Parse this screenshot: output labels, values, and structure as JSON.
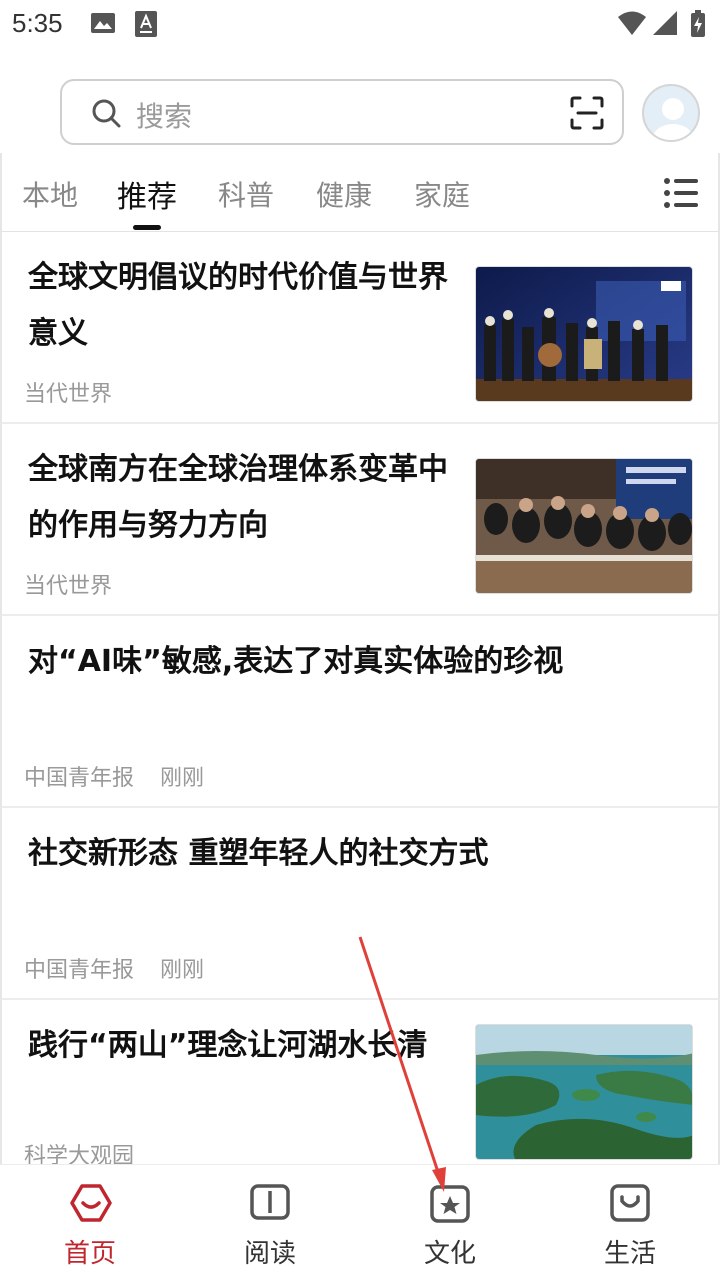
{
  "status_bar": {
    "time": "5:35"
  },
  "search": {
    "placeholder": "搜索"
  },
  "tabs": [
    {
      "label": "本地"
    },
    {
      "label": "推荐"
    },
    {
      "label": "科普"
    },
    {
      "label": "健康"
    },
    {
      "label": "家庭"
    }
  ],
  "news": [
    {
      "title": "全球文明倡议的时代价值与世界意义",
      "source": "当代世界",
      "time": ""
    },
    {
      "title": "全球南方在全球治理体系变革中的作用与努力方向",
      "source": "当代世界",
      "time": ""
    },
    {
      "title": "对“AI味”敏感,表达了对真实体验的珍视",
      "source": "中国青年报",
      "time": "刚刚"
    },
    {
      "title": "社交新形态 重塑年轻人的社交方式",
      "source": "中国青年报",
      "time": "刚刚"
    },
    {
      "title": "践行“两山”理念让河湖水长清",
      "source": "科学大观园",
      "time": ""
    }
  ],
  "bottom_nav": [
    {
      "label": "首页",
      "icon": "home-hexagon-icon",
      "active": true
    },
    {
      "label": "阅读",
      "icon": "book-icon",
      "active": false
    },
    {
      "label": "文化",
      "icon": "star-box-icon",
      "active": false
    },
    {
      "label": "生活",
      "icon": "smile-box-icon",
      "active": false
    }
  ],
  "colors": {
    "accent": "#c0262e",
    "annotation": "#e0403a"
  }
}
